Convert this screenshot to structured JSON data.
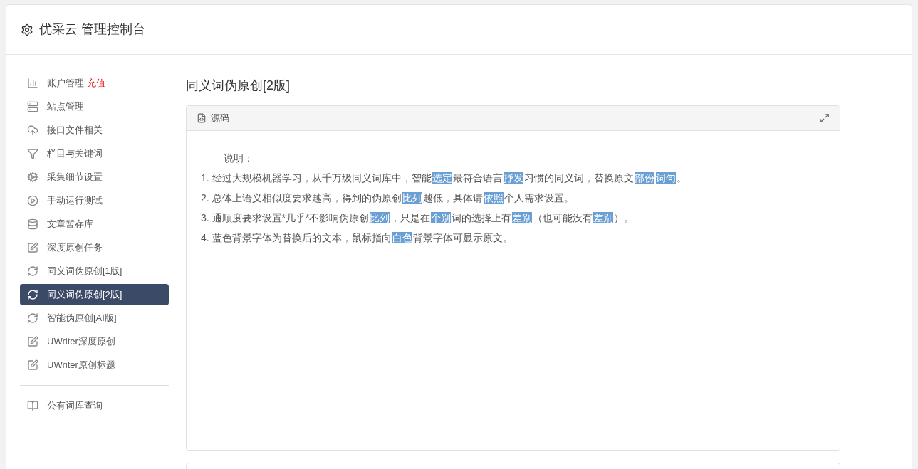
{
  "header": {
    "title": "优采云 管理控制台"
  },
  "sidebar": {
    "groups": [
      {
        "items": [
          {
            "label": "账户管理",
            "badge": "充值",
            "selected": false
          },
          {
            "label": "站点管理",
            "selected": false
          },
          {
            "label": "接口文件相关",
            "selected": false
          },
          {
            "label": "栏目与关键词",
            "selected": false
          },
          {
            "label": "采集细节设置",
            "selected": false
          },
          {
            "label": "手动运行测试",
            "selected": false
          },
          {
            "label": "文章暂存库",
            "selected": false
          },
          {
            "label": "深度原创任务",
            "selected": false
          },
          {
            "label": "同义词伪原创[1版]",
            "selected": false
          },
          {
            "label": "同义词伪原创[2版]",
            "selected": true
          },
          {
            "label": "智能伪原创[AI版]",
            "selected": false
          },
          {
            "label": "UWriter深度原创",
            "selected": false
          },
          {
            "label": "UWriter原创标题",
            "selected": false
          }
        ]
      },
      {
        "items": [
          {
            "label": "公有词库查询",
            "selected": false
          }
        ]
      }
    ]
  },
  "page_title": "同义词伪原创[2版]",
  "panel": {
    "title": "源码",
    "heading": "说明：",
    "lines": [
      [
        {
          "text": "1. 经过大规模机器学习，从千万级同义词库中，智能",
          "replaced": false
        },
        {
          "text": "选定",
          "replaced": true
        },
        {
          "text": "最符合语言",
          "replaced": false
        },
        {
          "text": "抒发",
          "replaced": true
        },
        {
          "text": "习惯的同义词，替换原文",
          "replaced": false
        },
        {
          "text": "部份",
          "replaced": true
        },
        {
          "text": "词句",
          "replaced": true
        },
        {
          "text": "。",
          "replaced": false
        }
      ],
      [
        {
          "text": "2. 总体上语义相似度要求越高，得到的伪原创",
          "replaced": false
        },
        {
          "text": "比列",
          "replaced": true
        },
        {
          "text": "越低，具体请",
          "replaced": false
        },
        {
          "text": "依照",
          "replaced": true
        },
        {
          "text": "个人需求设置。",
          "replaced": false
        }
      ],
      [
        {
          "text": "3. 通顺度要求设置*几乎*不影响伪原创",
          "replaced": false
        },
        {
          "text": "比列",
          "replaced": true
        },
        {
          "text": "，只是在",
          "replaced": false
        },
        {
          "text": "个别",
          "replaced": true
        },
        {
          "text": "词的选择上有",
          "replaced": false
        },
        {
          "text": "差别",
          "replaced": true
        },
        {
          "text": "（也可能没有",
          "replaced": false
        },
        {
          "text": "差别",
          "replaced": true
        },
        {
          "text": "）。",
          "replaced": false
        }
      ],
      [
        {
          "text": "4. 蓝色背景字体为替换后的文本，鼠标指向",
          "replaced": false
        },
        {
          "text": "白色",
          "replaced": true
        },
        {
          "text": "背景字体可显示原文。",
          "replaced": false
        }
      ]
    ]
  }
}
